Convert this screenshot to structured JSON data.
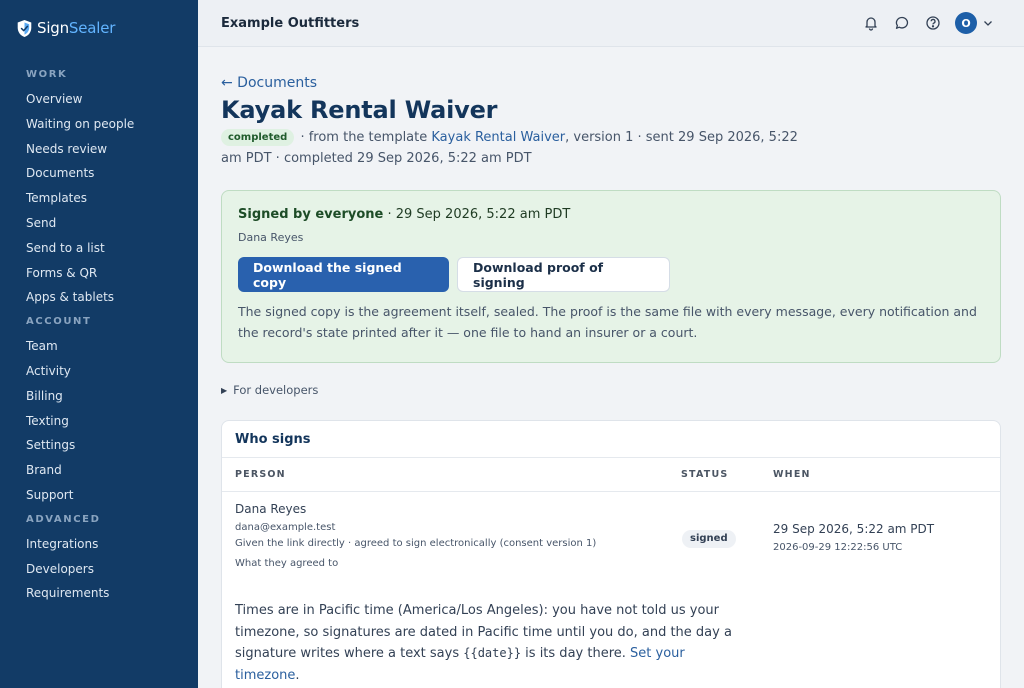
{
  "brand": {
    "name_primary": "Sign",
    "name_accent": "Sealer"
  },
  "sidebar": {
    "sections": [
      {
        "label": "WORK",
        "items": [
          "Overview",
          "Waiting on people",
          "Needs review",
          "Documents",
          "Templates",
          "Send",
          "Send to a list",
          "Forms & QR",
          "Apps & tablets"
        ]
      },
      {
        "label": "ACCOUNT",
        "items": [
          "Team",
          "Activity",
          "Billing",
          "Texting",
          "Settings",
          "Brand",
          "Support"
        ]
      },
      {
        "label": "ADVANCED",
        "items": [
          "Integrations",
          "Developers",
          "Requirements"
        ]
      }
    ]
  },
  "topbar": {
    "org_name": "Example Outfitters",
    "avatar_initial": "O"
  },
  "page": {
    "back_label": "← Documents",
    "title": "Kayak Rental Waiver",
    "status_pill": "completed",
    "meta_prefix": " · from the template ",
    "template_link": "Kayak Rental Waiver",
    "meta_suffix": ", version 1 · sent 29 Sep 2026, 5:22 am PDT · completed 29 Sep 2026, 5:22 am PDT"
  },
  "signed_card": {
    "heading_bold": "Signed by everyone",
    "heading_rest": " · 29 Sep 2026, 5:22 am PDT",
    "signer": "Dana Reyes",
    "download_signed_label": "Download the signed copy",
    "download_proof_label": "Download proof of signing",
    "note": "The signed copy is the agreement itself, sealed. The proof is the same file with every message, every notification and the record's state printed after it — one file to hand an insurer or a court."
  },
  "developers_toggle": "For developers",
  "signers": {
    "title": "Who signs",
    "columns": [
      "PERSON",
      "STATUS",
      "WHEN"
    ],
    "rows": [
      {
        "name": "Dana Reyes",
        "email": "dana@example.test",
        "consent": "Given the link directly · agreed to sign electronically (consent version 1)",
        "agreed_link": "What they agreed to",
        "status": "signed",
        "when_local": "29 Sep 2026, 5:22 am PDT",
        "when_utc": "2026-09-29 12:22:56 UTC"
      }
    ],
    "tz_note_prefix": "Times are in Pacific time (America/Los Angeles): you have not told us your timezone, so signatures are dated in Pacific time until you do, and the day a signature writes where a text says ",
    "tz_note_code": "{{date}}",
    "tz_note_middle": " is its day there. ",
    "tz_note_link": "Set your timezone",
    "tz_note_end": "."
  }
}
